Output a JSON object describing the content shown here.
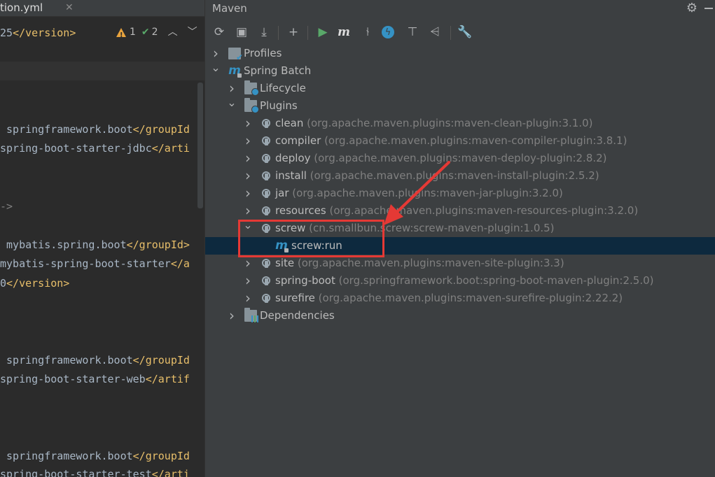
{
  "editor": {
    "tab_file": "tion.yml",
    "inspections": {
      "warnings": "1",
      "ok": "2"
    },
    "lines": [
      {
        "parts": [
          {
            "t": "v",
            "s": "25"
          },
          {
            "t": "t",
            "s": "</version>"
          }
        ]
      },
      {
        "parts": [
          {
            "t": "v",
            "s": " springframework.boot"
          },
          {
            "t": "t",
            "s": "</groupId"
          }
        ]
      },
      {
        "parts": [
          {
            "t": "v",
            "s": "spring-boot-starter-jdbc"
          },
          {
            "t": "t",
            "s": "</arti"
          }
        ]
      },
      {
        "parts": [
          {
            "t": "c",
            "s": "->"
          }
        ]
      },
      {
        "parts": [
          {
            "t": "v",
            "s": " mybatis.spring.boot"
          },
          {
            "t": "t",
            "s": "</groupId>"
          }
        ]
      },
      {
        "parts": [
          {
            "t": "v",
            "s": "mybatis-spring-boot-starter"
          },
          {
            "t": "t",
            "s": "</a"
          }
        ]
      },
      {
        "parts": [
          {
            "t": "v",
            "s": "0"
          },
          {
            "t": "t",
            "s": "</version>"
          }
        ]
      },
      {
        "parts": [
          {
            "t": "v",
            "s": " springframework.boot"
          },
          {
            "t": "t",
            "s": "</groupId"
          }
        ]
      },
      {
        "parts": [
          {
            "t": "v",
            "s": "spring-boot-starter-web"
          },
          {
            "t": "t",
            "s": "</artif"
          }
        ]
      },
      {
        "parts": [
          {
            "t": "v",
            "s": " springframework.boot"
          },
          {
            "t": "t",
            "s": "</groupId"
          }
        ]
      },
      {
        "parts": [
          {
            "t": "v",
            "s": "spring-boot-starter-test"
          },
          {
            "t": "t",
            "s": "</arti"
          }
        ]
      }
    ]
  },
  "maven": {
    "title": "Maven",
    "toolbar": [
      {
        "icon": "reload-icon",
        "glyph": "⟳"
      },
      {
        "icon": "add-source-folder-icon",
        "glyph": "▣"
      },
      {
        "icon": "download-icon",
        "glyph": "⤓"
      },
      {
        "icon": "plus-icon",
        "glyph": "+"
      },
      {
        "icon": "run-icon",
        "glyph": "▶"
      },
      {
        "icon": "execute-goal-icon",
        "glyph": "m"
      },
      {
        "icon": "toggle-offline-icon",
        "glyph": "⫮"
      },
      {
        "icon": "skip-tests-icon",
        "glyph": "ϟ"
      },
      {
        "icon": "show-dependencies-icon",
        "glyph": "⊤"
      },
      {
        "icon": "collapse-all-icon",
        "glyph": "⩤"
      },
      {
        "icon": "settings-wrench-icon",
        "glyph": "🔧"
      }
    ],
    "tree": [
      {
        "name": "Profiles",
        "sub": "",
        "icon": "profiles",
        "chev": "›",
        "level": 0
      },
      {
        "name": "Spring Batch",
        "sub": "",
        "icon": "m",
        "chev": "⌄",
        "level": 0
      },
      {
        "name": "Lifecycle",
        "sub": "",
        "icon": "folder-gear",
        "chev": "›",
        "level": 1
      },
      {
        "name": "Plugins",
        "sub": "",
        "icon": "folder-gear",
        "chev": "⌄",
        "level": 1
      },
      {
        "name": "clean",
        "sub": " (org.apache.maven.plugins:maven-clean-plugin:3.1.0)",
        "icon": "plugin",
        "chev": "›",
        "level": 2
      },
      {
        "name": "compiler",
        "sub": " (org.apache.maven.plugins:maven-compiler-plugin:3.8.1)",
        "icon": "plugin",
        "chev": "›",
        "level": 2
      },
      {
        "name": "deploy",
        "sub": " (org.apache.maven.plugins:maven-deploy-plugin:2.8.2)",
        "icon": "plugin",
        "chev": "›",
        "level": 2
      },
      {
        "name": "install",
        "sub": " (org.apache.maven.plugins:maven-install-plugin:2.5.2)",
        "icon": "plugin",
        "chev": "›",
        "level": 2
      },
      {
        "name": "jar",
        "sub": " (org.apache.maven.plugins:maven-jar-plugin:3.2.0)",
        "icon": "plugin",
        "chev": "›",
        "level": 2
      },
      {
        "name": "resources",
        "sub": " (org.apache.maven.plugins:maven-resources-plugin:3.2.0)",
        "icon": "plugin",
        "chev": "›",
        "level": 2
      },
      {
        "name": "screw",
        "sub": " (cn.smallbun.screw:screw-maven-plugin:1.0.5)",
        "icon": "plugin",
        "chev": "⌄",
        "level": 2
      },
      {
        "name": "screw:run",
        "sub": "",
        "icon": "goal",
        "chev": "",
        "level": 3,
        "selected": true
      },
      {
        "name": "site",
        "sub": " (org.apache.maven.plugins:maven-site-plugin:3.3)",
        "icon": "plugin",
        "chev": "›",
        "level": 2
      },
      {
        "name": "spring-boot",
        "sub": " (org.springframework.boot:spring-boot-maven-plugin:2.5.0)",
        "icon": "plugin",
        "chev": "›",
        "level": 2
      },
      {
        "name": "surefire",
        "sub": " (org.apache.maven.plugins:maven-surefire-plugin:2.22.2)",
        "icon": "plugin",
        "chev": "›",
        "level": 2
      },
      {
        "name": "Dependencies",
        "sub": "",
        "icon": "folder-bars",
        "chev": "›",
        "level": 1
      }
    ]
  },
  "colors": {
    "annotation_red": "#e53935",
    "selection": "#0d293e",
    "xml_tag": "#e8bf6a"
  }
}
